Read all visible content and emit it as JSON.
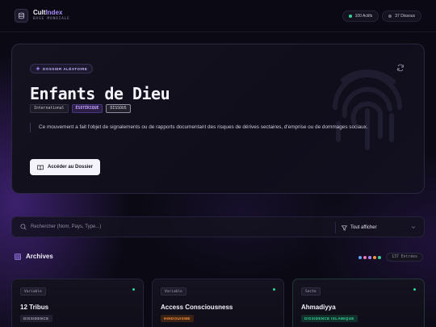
{
  "brand": {
    "title_main": "Cult",
    "title_accent": "Index",
    "subtitle": "BASE MONDIALE"
  },
  "header": {
    "active": {
      "label": "100 Actifs",
      "color": "#34d399"
    },
    "dissolved": {
      "label": "37 Dissous",
      "color": "#6b6880"
    }
  },
  "hero": {
    "tag": "DOSSIER ALÉATOIRE",
    "title": "Enfants de Dieu",
    "badges": [
      "International",
      "ÉSOTÉRIQUE",
      "DISSOUS"
    ],
    "description": "Ce mouvement a fait l'objet de signalements ou de rapports documentant des risques de dérives sectaires, d'emprise ou de dommages sociaux.",
    "cta": "Accéder au Dossier",
    "icons": [
      "sparkle-icon",
      "refresh-icon",
      "fingerprint-icon",
      "book-icon"
    ]
  },
  "search": {
    "placeholder": "Rechercher (Nom, Pays, Type...)",
    "filter_label": "Tout afficher"
  },
  "archives": {
    "title": "Archives",
    "entries": "137 Entrées",
    "dot_colors": [
      "#60a5fa",
      "#f472b6",
      "#a78bfa",
      "#fb923c",
      "#34d399"
    ]
  },
  "cards": [
    {
      "type": "Variable",
      "name": "12 Tribus",
      "tag": "DISSIDENCE",
      "tag_color": "#a3a0b8",
      "tag_bg": "#22202e",
      "dot": "#34d399"
    },
    {
      "type": "Variable",
      "name": "Access Consciousness",
      "tag": "HINDOUISME",
      "tag_color": "#fb923c",
      "tag_bg": "#3a2314",
      "dot": "#34d399"
    },
    {
      "type": "Secte",
      "name": "Ahmadiyya",
      "tag": "DISSIDENCE ISLAMIQUE",
      "tag_color": "#34d399",
      "tag_bg": "#12302a",
      "dot": "#34d399"
    }
  ]
}
